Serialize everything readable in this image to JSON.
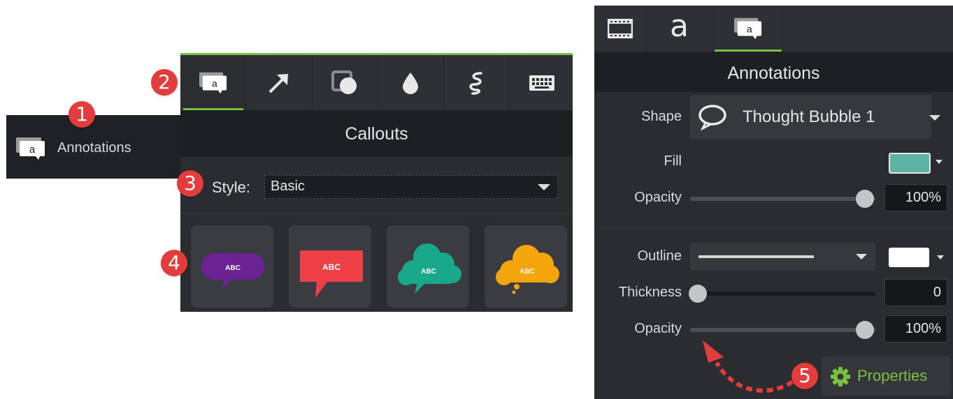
{
  "left_strip": {
    "label": "Annotations"
  },
  "badges": [
    "1",
    "2",
    "3",
    "4",
    "5"
  ],
  "middle_panel": {
    "tabs": [
      "annotations-icon",
      "arrow-icon",
      "shapes-icon",
      "blur-icon",
      "sketch-motion-icon",
      "keyboard-icon"
    ],
    "header": "Callouts",
    "style_label": "Style:",
    "style_value": "Basic",
    "callouts": [
      {
        "name": "speech-bubble",
        "text": "ABC",
        "color": "#6b2394"
      },
      {
        "name": "rectangle-callout",
        "text": "ABC",
        "color": "#ef3f46"
      },
      {
        "name": "cloud-callout",
        "text": "ABC",
        "color": "#1aa88a"
      },
      {
        "name": "thought-bubble",
        "text": "ABC",
        "color": "#f4a50b"
      }
    ]
  },
  "right_panel": {
    "tabs": [
      "film-icon",
      "text-a-icon",
      "annotations-icon"
    ],
    "tab_text_glyph": "a",
    "header": "Annotations",
    "shape_label": "Shape",
    "shape_value": "Thought Bubble 1",
    "fill_label": "Fill",
    "fill_color": "#5fb3a3",
    "opacity_label": "Opacity",
    "opacity_value": "100%",
    "opacity_level": 1.0,
    "outline_label": "Outline",
    "outline_color": "#ffffff",
    "thickness_label": "Thickness",
    "thickness_value": "0",
    "thickness_level": 0,
    "outline_opacity_label": "Opacity",
    "outline_opacity_value": "100%",
    "outline_opacity_level": 1.0,
    "properties_label": "Properties"
  },
  "colors": {
    "accent_green": "#7bc043",
    "badge_red": "#e23c3c"
  }
}
